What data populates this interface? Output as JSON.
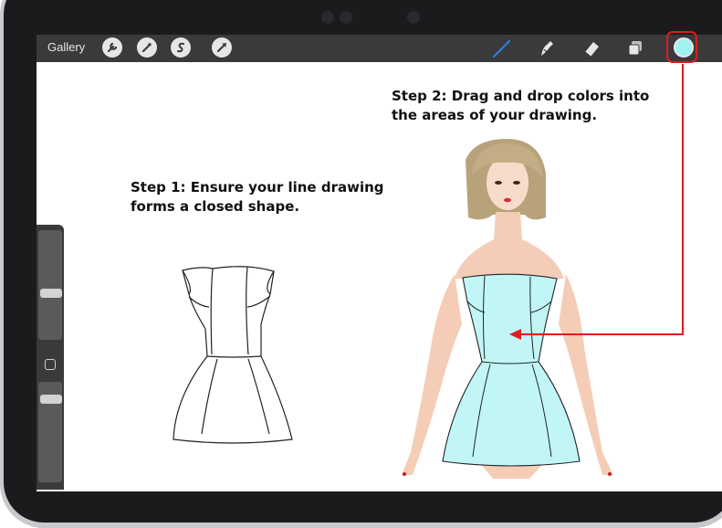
{
  "toolbar": {
    "gallery_label": "Gallery",
    "left_tools": [
      "wrench-icon",
      "magic-wand-icon",
      "selection-icon",
      "transform-arrow-icon"
    ],
    "right_tools": [
      "brush-icon",
      "smudge-icon",
      "eraser-icon",
      "layers-icon"
    ],
    "current_color": "#9ef3f0"
  },
  "canvas": {
    "step1": {
      "line1": "Step 1: Ensure your line drawing",
      "line2": "forms a closed shape."
    },
    "step2": {
      "line1": "Step 2: Drag and drop colors into",
      "line2": "the areas of your drawing."
    }
  },
  "colors": {
    "dress_fill": "#c2f6f6",
    "annotation_red": "#e21b1b",
    "brush_blue": "#2f7be0"
  }
}
